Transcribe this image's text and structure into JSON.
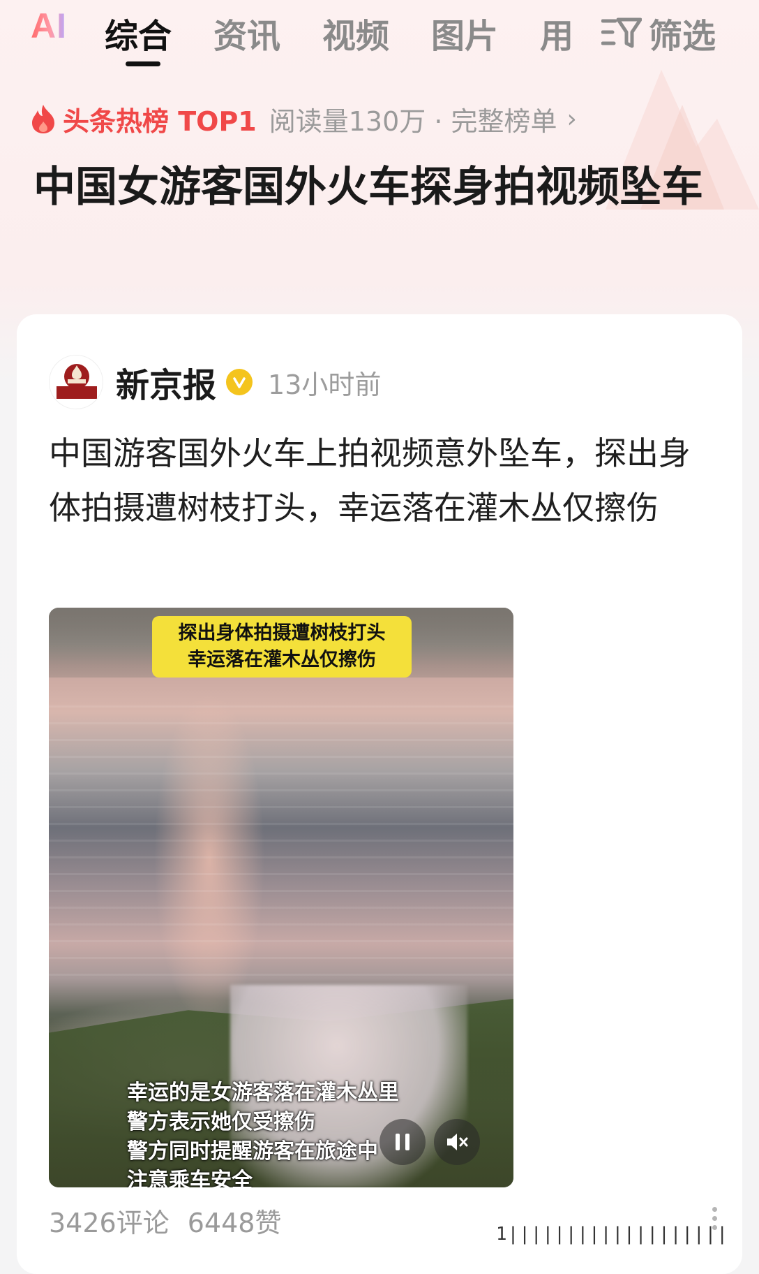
{
  "tabs": {
    "ai": "AI",
    "items": [
      "综合",
      "资讯",
      "视频",
      "图片",
      "用"
    ],
    "active_index": 0,
    "filter_label": "筛选"
  },
  "hotlist": {
    "title": "头条热榜 TOP1",
    "meta": "阅读量130万 · 完整榜单",
    "chevron": "›"
  },
  "headline": "中国女游客国外火车探身拍视频坠车",
  "card": {
    "source_name": "新京报",
    "source_logo_text": "新京报",
    "time": "13小时前",
    "summary": "中国游客国外火车上拍视频意外坠车，探出身体拍摄遭树枝打头，幸运落在灌木丛仅擦伤",
    "video": {
      "caption_top": [
        "探出身体拍摄遭树枝打头",
        "幸运落在灌木丛仅擦伤"
      ],
      "caption_bottom": [
        "幸运的是女游客落在灌木丛里",
        "警方表示她仅受擦伤",
        "警方同时提醒游客在旅途中",
        "注意乘车安全"
      ]
    },
    "comments": "3426评论",
    "likes": "6448赞",
    "watermark": "1|||||||||||||||||||"
  },
  "colors": {
    "hot_red": "#f04848",
    "active_tab": "#111111",
    "inactive_tab": "#8a8a8a",
    "verified_badge": "#f4c41d"
  }
}
